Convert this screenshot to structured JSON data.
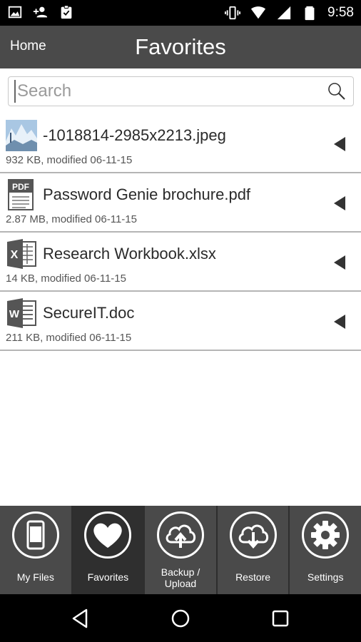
{
  "status_bar": {
    "time": "9:58",
    "left_icons": [
      "image-notification-icon",
      "person-add-icon",
      "clipboard-check-icon"
    ],
    "right_icons": [
      "vibrate-icon",
      "wifi-icon",
      "signal-icon",
      "battery-icon"
    ]
  },
  "app_bar": {
    "home_label": "Home",
    "title": "Favorites"
  },
  "search": {
    "placeholder": "Search",
    "value": ""
  },
  "files": [
    {
      "name": "-1018814-2985x2213.jpeg",
      "meta": "932 KB, modified 06-11-15",
      "icon": "image-thumbnail-icon"
    },
    {
      "name": "Password Genie brochure.pdf",
      "meta": "2.87 MB, modified 06-11-15",
      "icon": "pdf-icon"
    },
    {
      "name": "Research Workbook.xlsx",
      "meta": "14 KB, modified 06-11-15",
      "icon": "excel-icon"
    },
    {
      "name": "SecureIT.doc",
      "meta": "211 KB, modified 06-11-15",
      "icon": "word-icon"
    }
  ],
  "tabs": [
    {
      "label": "My Files",
      "icon": "phone-icon",
      "active": false
    },
    {
      "label": "Favorites",
      "icon": "heart-icon",
      "active": true
    },
    {
      "label": "Backup /\nUpload",
      "icon": "cloud-upload-icon",
      "active": false
    },
    {
      "label": "Restore",
      "icon": "cloud-download-icon",
      "active": false
    },
    {
      "label": "Settings",
      "icon": "gear-icon",
      "active": false
    }
  ],
  "colors": {
    "app_bar": "#4a4a4a",
    "active_tab": "#2f2f2f",
    "divider": "#b5b5b5"
  }
}
